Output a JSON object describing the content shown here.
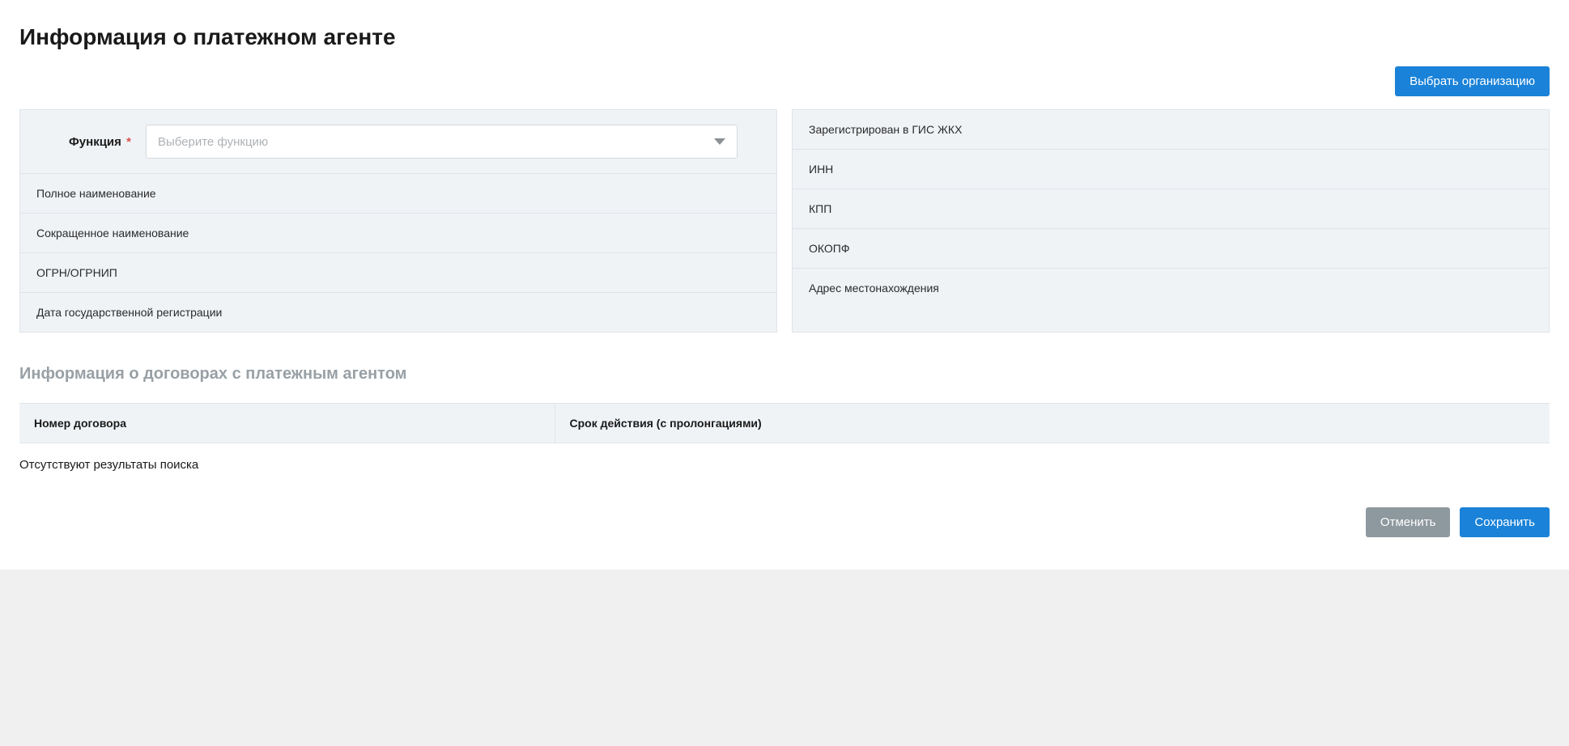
{
  "page": {
    "title": "Информация о платежном агенте"
  },
  "actions": {
    "select_org": "Выбрать организацию",
    "cancel": "Отменить",
    "save": "Сохранить"
  },
  "function_field": {
    "label": "Функция",
    "required_mark": "*",
    "placeholder": "Выберите функцию"
  },
  "left_fields": {
    "full_name": "Полное наименование",
    "short_name": "Сокращенное наименование",
    "ogrn": "ОГРН/ОГРНИП",
    "reg_date": "Дата государственной регистрации"
  },
  "right_fields": {
    "gis_reg": "Зарегистрирован в ГИС ЖКХ",
    "inn": "ИНН",
    "kpp": "КПП",
    "okopf": "ОКОПФ",
    "address": "Адрес местонахождения"
  },
  "contracts": {
    "section_title": "Информация о договорах с платежным агентом",
    "columns": {
      "number": "Номер договора",
      "term": "Срок действия (с пролонгациями)"
    },
    "empty_text": "Отсутствуют результаты поиска"
  }
}
